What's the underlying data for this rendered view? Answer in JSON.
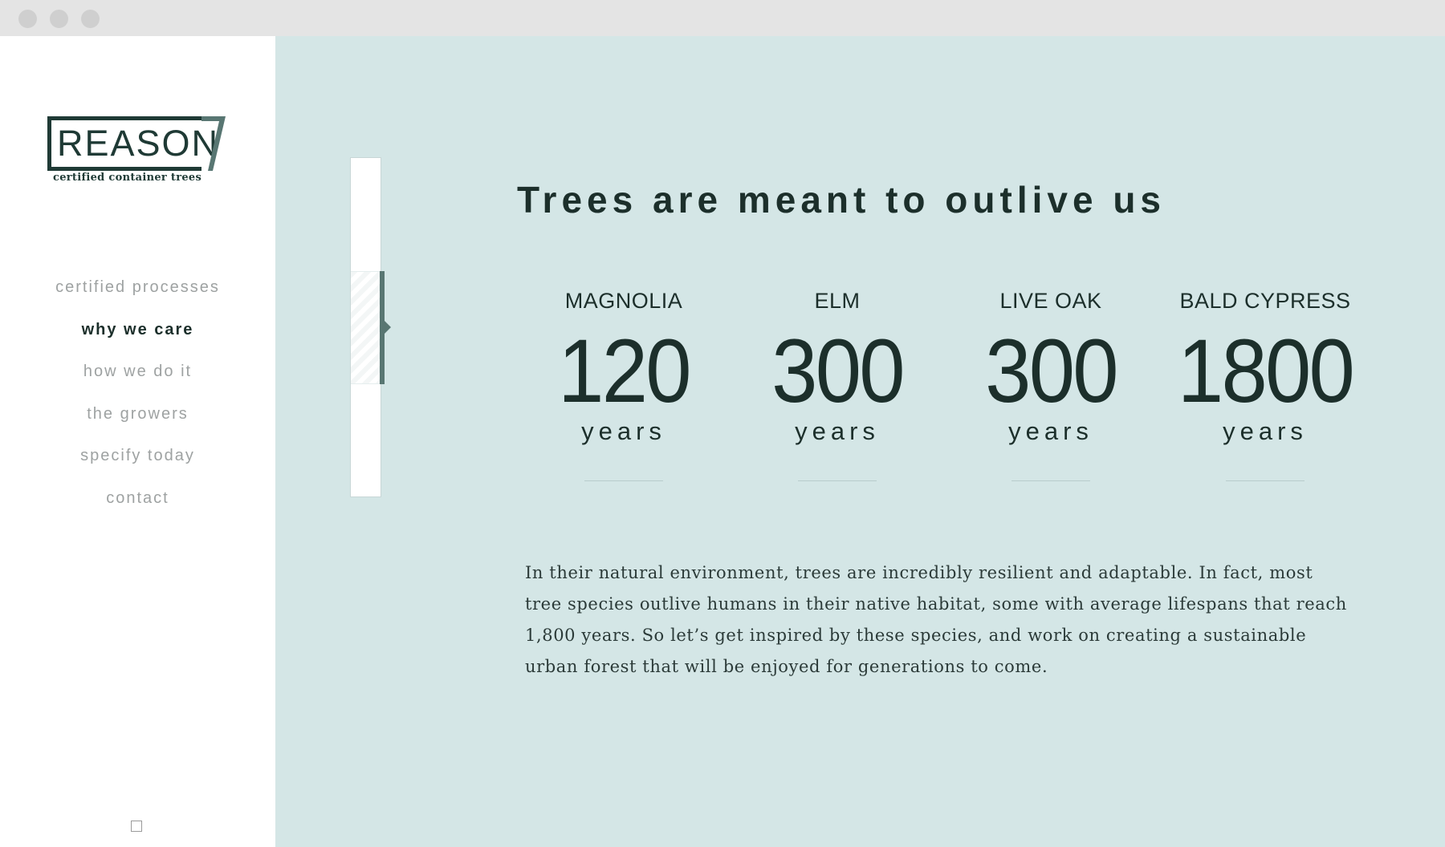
{
  "window": {
    "controls": [
      "close",
      "minimize",
      "maximize"
    ]
  },
  "brand": {
    "wordmark": "REASON",
    "mark": "7",
    "tagline": "certified container trees",
    "color": "#1f3a35"
  },
  "nav": {
    "items": [
      {
        "label": "certified processes",
        "active": false
      },
      {
        "label": "why we care",
        "active": true
      },
      {
        "label": "how we do it",
        "active": false
      },
      {
        "label": "the growers",
        "active": false
      },
      {
        "label": "specify today",
        "active": false
      },
      {
        "label": "contact",
        "active": false
      }
    ]
  },
  "section_indicator": {
    "current": 2,
    "total": 3
  },
  "main": {
    "headline": "Trees are meant to outlive us",
    "stats": [
      {
        "name": "MAGNOLIA",
        "value": "120",
        "unit": "years"
      },
      {
        "name": "ELM",
        "value": "300",
        "unit": "years"
      },
      {
        "name": "LIVE OAK",
        "value": "300",
        "unit": "years"
      },
      {
        "name": "BALD CYPRESS",
        "value": "1800",
        "unit": "years"
      }
    ],
    "body": "In their natural environment, trees are incredibly resilient and adaptable. In fact, most tree species outlive humans in their native habitat, some with average lifespans that reach 1,800 years. So let’s get inspired by these species, and work on creating a sustainable urban forest that will be enjoyed for generations to come."
  },
  "colors": {
    "background": "#d4e6e6",
    "sidebar": "#ffffff",
    "text_dark": "#1c2f2b",
    "nav_inactive": "#9ea2a2",
    "accent": "#587672"
  }
}
